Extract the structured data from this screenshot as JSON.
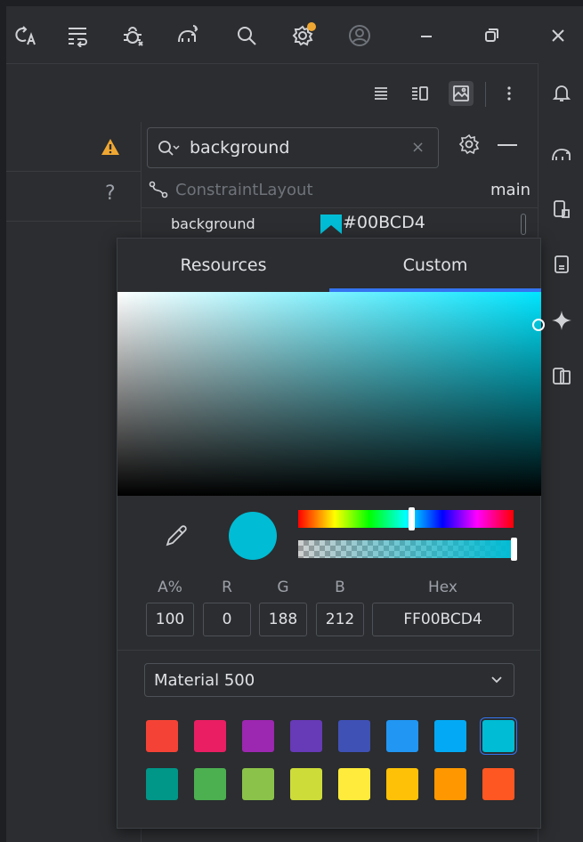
{
  "titlebar": {
    "icons": [
      "translate-icon",
      "wrap-text-icon",
      "debug-icon",
      "elephant-sync-icon",
      "search-icon",
      "settings-icon",
      "account-icon",
      "minimize-icon",
      "restore-icon",
      "close-icon"
    ]
  },
  "toolbar": {
    "icons": [
      "code-view-icon",
      "split-view-icon",
      "design-view-icon",
      "more-icon"
    ]
  },
  "right_strip": {
    "icons": [
      "notifications-icon",
      "gradle-icon",
      "device-manager-icon",
      "clipboard-icon",
      "gemini-icon",
      "running-devices-icon"
    ]
  },
  "left_pane": {
    "help": "?"
  },
  "attributes": {
    "search_value": "background",
    "clear": "×",
    "component_name": "ConstraintLayout",
    "component_right": "main",
    "attr_name": "background",
    "attr_value": "#00BCD4"
  },
  "picker": {
    "tabs": [
      "Resources",
      "Custom"
    ],
    "active_tab": "Custom",
    "current_color": "#00BCD4",
    "hue_fraction": 0.52,
    "alpha_fraction": 1.0,
    "channels": {
      "labels": [
        "A%",
        "R",
        "G",
        "B",
        "Hex"
      ],
      "values": [
        "100",
        "0",
        "188",
        "212",
        "FF00BCD4"
      ]
    },
    "palette": {
      "selected": "Material 500",
      "row1": [
        "#f44336",
        "#e91e63",
        "#9c27b0",
        "#673ab7",
        "#3f51b5",
        "#2196f3",
        "#03a9f4",
        "#00bcd4"
      ],
      "row2": [
        "#009688",
        "#4caf50",
        "#8bc34a",
        "#cddc39",
        "#ffeb3b",
        "#ffc107",
        "#ff9800",
        "#ff5722"
      ]
    }
  },
  "colors": {
    "accent": "#3574f0",
    "warning": "#f0a732"
  }
}
